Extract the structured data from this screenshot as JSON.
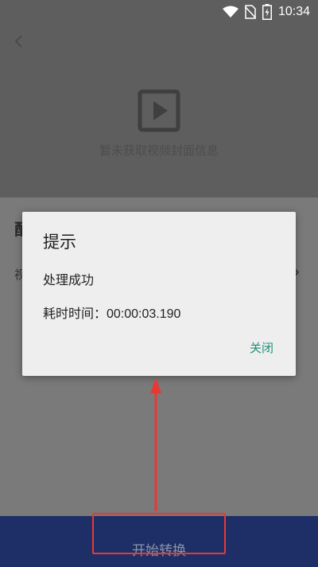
{
  "status_bar": {
    "time": "10:34",
    "icons": [
      "wifi-icon",
      "no-sim-icon",
      "battery-charging-icon"
    ]
  },
  "header": {
    "back_icon": "chevron-left-icon",
    "video_icon": "video-play-icon",
    "cover_text": "暂未获取视频封面信息"
  },
  "content": {
    "section_fragment": "配",
    "row_fragment": "视"
  },
  "dialog": {
    "title": "提示",
    "message": "处理成功",
    "elapsed_label": "耗时时间：",
    "elapsed_value": "00:00:03.190",
    "close_label": "关闭"
  },
  "bottom_bar": {
    "start_label": "开始转换"
  },
  "colors": {
    "annotation": "#e53935",
    "dialog_accent": "#1f8f7a",
    "bottom_bar": "#1d2f66"
  }
}
